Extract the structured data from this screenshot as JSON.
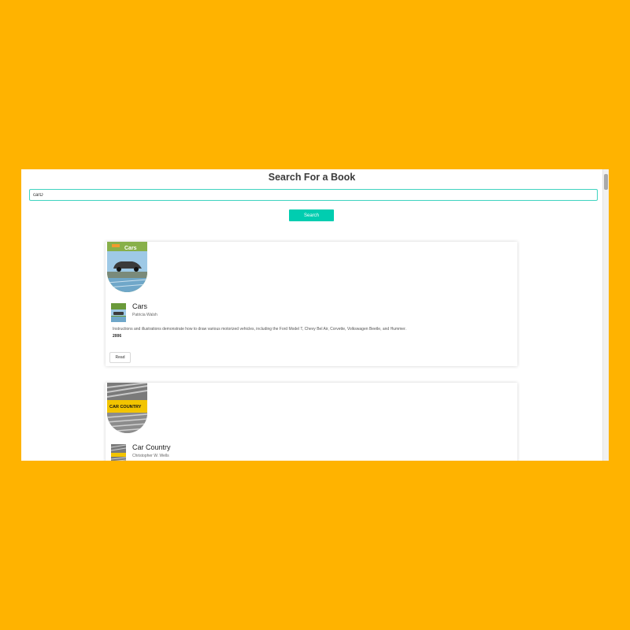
{
  "page": {
    "title": "Search For a Book"
  },
  "search": {
    "value": "carD",
    "button_label": "Search"
  },
  "results": [
    {
      "cover_text": "Cars",
      "title": "Cars",
      "author": "Patricia Walsh",
      "description": "Instructions and illustrations demonstrate how to draw various motorized vehicles, including the Ford Model T, Chevy Bel Air, Corvette, Volkswagen Beetle, and Hummer.",
      "year": "2006",
      "read_label": "Read"
    },
    {
      "cover_text": "CAR COUNTRY",
      "title": "Car Country",
      "author": "Christopher W. Wells"
    }
  ],
  "colors": {
    "background": "#FFB300",
    "accent": "#00cdb0",
    "input_border": "#3fd3c0"
  }
}
